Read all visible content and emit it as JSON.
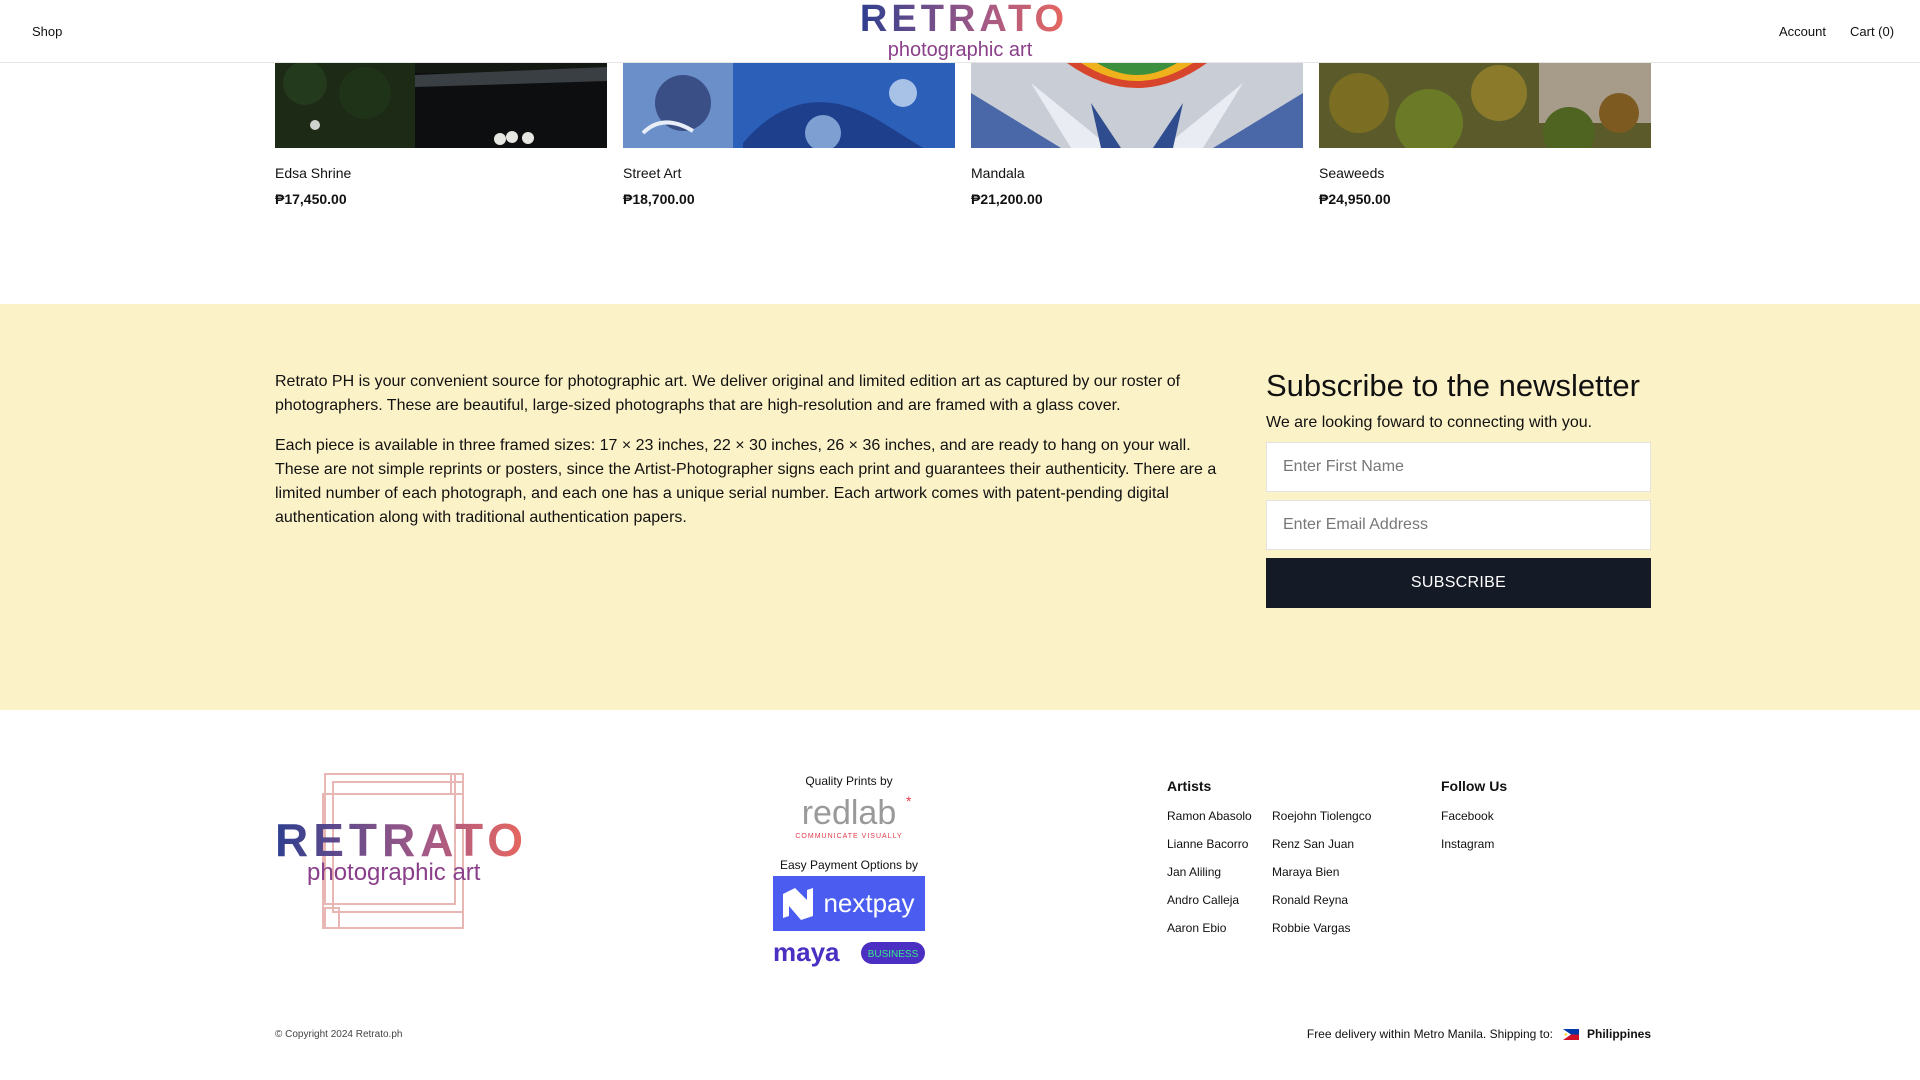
{
  "header": {
    "shop_label": "Shop",
    "account_label": "Account",
    "cart_label": "Cart (0)",
    "logo_word": "RETRATO",
    "logo_tagline": "photographic art"
  },
  "products": [
    {
      "name": "Edsa Shrine",
      "price": "₱17,450.00"
    },
    {
      "name": "Street Art",
      "price": "₱18,700.00"
    },
    {
      "name": "Mandala",
      "price": "₱21,200.00"
    },
    {
      "name": "Seaweeds",
      "price": "₱24,950.00"
    }
  ],
  "about": {
    "paragraph1": "Retrato PH is your convenient source for photographic art. We deliver original and limited edition art as captured by our roster of photographers. These are beautiful, large-sized photographs that are high-resolution and are framed with a glass cover.",
    "paragraph2": "Each piece is available in three framed sizes: 17 × 23 inches, 22 × 30 inches, 26 × 36 inches, and are ready to hang on your wall. These are not simple reprints or posters, since the Artist-Photographer signs each print and guarantees their authenticity. There are a limited number of each photograph, and each one has a unique serial number. Each artwork comes with patent-pending digital authentication along with traditional authentication papers."
  },
  "newsletter": {
    "title": "Subscribe to the newsletter",
    "subtitle": "We are looking foward to connecting with you.",
    "first_name_placeholder": "Enter First Name",
    "email_placeholder": "Enter Email Address",
    "button_label": "SUBSCRIBE"
  },
  "footer": {
    "logo_word": "RETRATO",
    "logo_tagline": "photographic art",
    "quality_caption": "Quality Prints by",
    "redlab_name": "redlab",
    "redlab_tagline": "COMMUNICATE VISUALLY",
    "payment_caption": "Easy Payment Options by",
    "nextpay_name": "nextpay",
    "maya_name": "maya",
    "maya_badge": "BUSINESS",
    "artists_title": "Artists",
    "artists_col1": [
      "Ramon Abasolo",
      "Lianne Bacorro",
      "Jan Aliling",
      "Andro Calleja",
      "Aaron Ebio"
    ],
    "artists_col2": [
      "Roejohn Tiolengco",
      "Renz San Juan",
      "Maraya Bien",
      "Ronald Reyna",
      "Robbie Vargas"
    ],
    "follow_title": "Follow Us",
    "follow_links": [
      "Facebook",
      "Instagram"
    ],
    "copyright": "© Copyright 2024 Retrato.ph",
    "shipping_text": "Free delivery within Metro Manila. Shipping to:",
    "country": "Philippines"
  },
  "colors": {
    "band_background": "#fcf2c7",
    "button_dark": "#141a26",
    "logo_gradient_start": "#2f3f8f",
    "logo_gradient_end": "#e9675e",
    "tagline_purple": "#8a3f8a",
    "nextpay_blue": "#4a5df0",
    "maya_purple": "#4a2fc2"
  }
}
